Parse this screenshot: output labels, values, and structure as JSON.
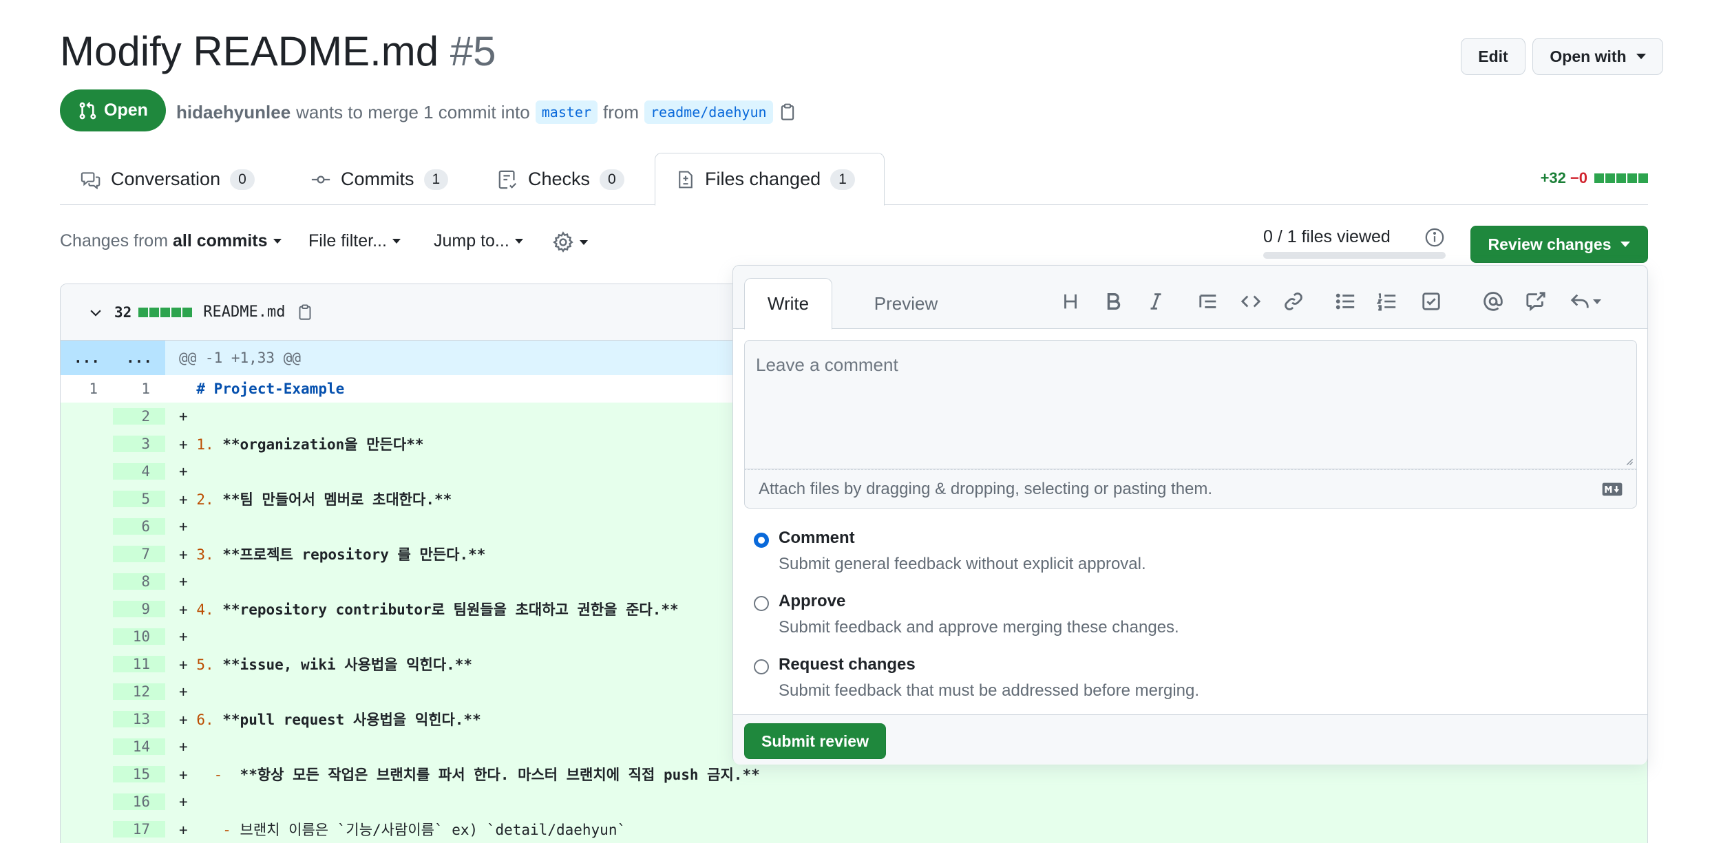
{
  "header": {
    "title": "Modify README.md",
    "number": "#5",
    "edit_label": "Edit",
    "open_with_label": "Open with"
  },
  "pr_meta": {
    "state": "Open",
    "author": "hidaehyunlee",
    "text": "wants to merge 1 commit into",
    "base_branch": "master",
    "from_text": "from",
    "head_branch": "readme/daehyun"
  },
  "tabs": [
    {
      "label": "Conversation",
      "count": "0"
    },
    {
      "label": "Commits",
      "count": "1"
    },
    {
      "label": "Checks",
      "count": "0"
    },
    {
      "label": "Files changed",
      "count": "1"
    }
  ],
  "diffstat": {
    "additions": "+32",
    "deletions": "−0"
  },
  "toolbar": {
    "changes_prefix": "Changes from",
    "changes_value": "all commits",
    "file_filter": "File filter...",
    "jump_to": "Jump to...",
    "files_viewed": "0 / 1 files viewed",
    "review_changes": "Review changes"
  },
  "file": {
    "change_count": "32",
    "name": "README.md",
    "hunk_header": "@@ -1 +1,33 @@",
    "hunk_gutter": "...",
    "lines": [
      {
        "old": "1",
        "new": "1",
        "sign": " ",
        "num": "",
        "text": "# Project-Example"
      },
      {
        "old": "",
        "new": "2",
        "sign": "+",
        "num": "",
        "text": ""
      },
      {
        "old": "",
        "new": "3",
        "sign": "+",
        "num": "1.",
        "text": "**organization을 만든다**"
      },
      {
        "old": "",
        "new": "4",
        "sign": "+",
        "num": "",
        "text": ""
      },
      {
        "old": "",
        "new": "5",
        "sign": "+",
        "num": "2.",
        "text": "**팀 만들어서 멤버로 초대한다.**"
      },
      {
        "old": "",
        "new": "6",
        "sign": "+",
        "num": "",
        "text": ""
      },
      {
        "old": "",
        "new": "7",
        "sign": "+",
        "num": "3.",
        "text": "**프로젝트 repository 를 만든다.**"
      },
      {
        "old": "",
        "new": "8",
        "sign": "+",
        "num": "",
        "text": ""
      },
      {
        "old": "",
        "new": "9",
        "sign": "+",
        "num": "4.",
        "text": "**repository contributor로 팀원들을 초대하고 권한을 준다.**"
      },
      {
        "old": "",
        "new": "10",
        "sign": "+",
        "num": "",
        "text": ""
      },
      {
        "old": "",
        "new": "11",
        "sign": "+",
        "num": "5.",
        "text": "**issue, wiki 사용법을 익힌다.**"
      },
      {
        "old": "",
        "new": "12",
        "sign": "+",
        "num": "",
        "text": ""
      },
      {
        "old": "",
        "new": "13",
        "sign": "+",
        "num": "6.",
        "text": "**pull request 사용법을 익힌다.**"
      },
      {
        "old": "",
        "new": "14",
        "sign": "+",
        "num": "",
        "text": ""
      },
      {
        "old": "",
        "new": "15",
        "sign": "+",
        "num": "  -",
        "text": " **항상 모든 작업은 브랜치를 파서 한다. 마스터 브랜치에 직접 push 금지.**"
      },
      {
        "old": "",
        "new": "16",
        "sign": "+",
        "num": "",
        "text": ""
      },
      {
        "old": "",
        "new": "17",
        "sign": "+",
        "num": "   -",
        "text": "브랜치 이름은 `기능/사람이름` ex) `detail/daehyun`"
      }
    ]
  },
  "review_panel": {
    "write_tab": "Write",
    "preview_tab": "Preview",
    "placeholder": "Leave a comment",
    "attach_text": "Attach files by dragging & dropping, selecting or pasting them.",
    "options": [
      {
        "title": "Comment",
        "desc": "Submit general feedback without explicit approval.",
        "checked": true
      },
      {
        "title": "Approve",
        "desc": "Submit feedback and approve merging these changes.",
        "checked": false
      },
      {
        "title": "Request changes",
        "desc": "Submit feedback that must be addressed before merging.",
        "checked": false
      }
    ],
    "submit_label": "Submit review"
  },
  "colors": {
    "accent_green": "#1f883d",
    "added_bg": "#e6ffec",
    "link_blue": "#0969da"
  }
}
